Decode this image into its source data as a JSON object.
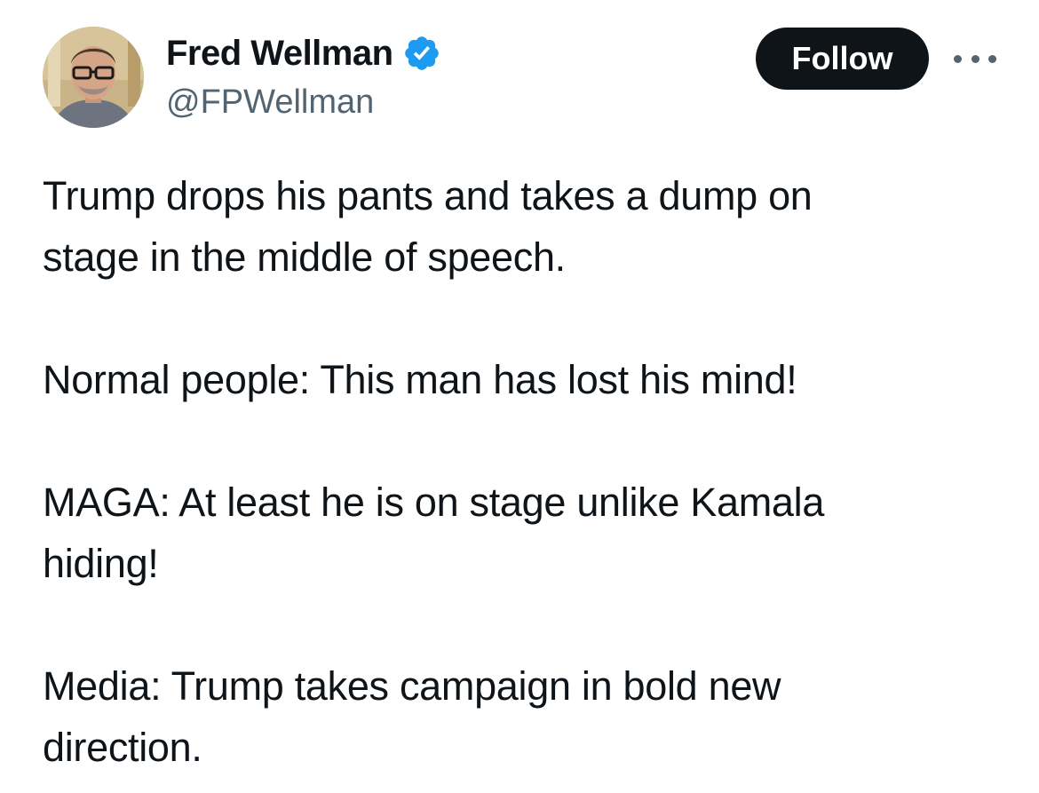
{
  "author": {
    "display_name": "Fred Wellman",
    "handle": "@FPWellman",
    "verified": true,
    "avatar_icon": "profile-photo",
    "verified_icon": "verified-badge-icon"
  },
  "actions": {
    "follow_label": "Follow",
    "more_icon": "more-options-icon"
  },
  "tweet": {
    "paragraphs": [
      [
        "Trump drops his pants and takes a dump on",
        "stage in the middle of speech."
      ],
      [
        "Normal people: This man has lost his mind!"
      ],
      [
        "MAGA: At least he is on stage unlike Kamala",
        "hiding!"
      ],
      [
        "Media: Trump takes campaign in bold new",
        "direction."
      ]
    ]
  },
  "colors": {
    "text_primary": "#0f1419",
    "text_secondary": "#536471",
    "verified_blue": "#1d9bf0",
    "follow_bg": "#0f1419",
    "follow_text": "#ffffff"
  }
}
